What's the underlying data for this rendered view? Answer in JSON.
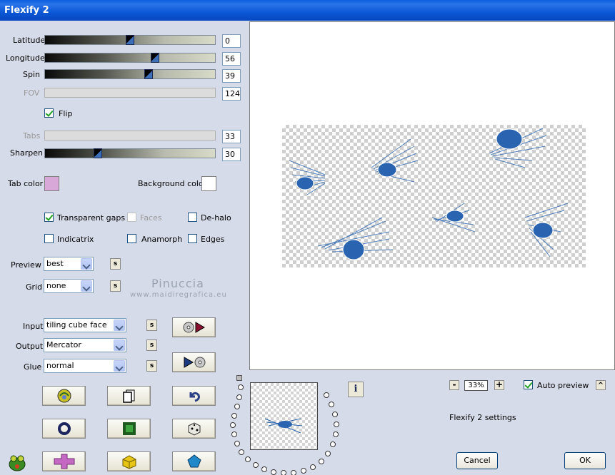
{
  "window": {
    "title": "Flexify 2"
  },
  "sliders": {
    "latitude": {
      "label": "Latitude",
      "value": "0",
      "level": 0.5
    },
    "longitude": {
      "label": "Longitude",
      "value": "56",
      "level": 0.65
    },
    "spin": {
      "label": "Spin",
      "value": "39",
      "level": 0.6
    },
    "fov": {
      "label": "FOV",
      "value": "124"
    },
    "tabs": {
      "label": "Tabs",
      "value": "33"
    },
    "sharpen": {
      "label": "Sharpen",
      "value": "30",
      "level": 0.3
    }
  },
  "flip": {
    "label": "Flip",
    "checked": true
  },
  "colors": {
    "tab_color_label": "Tab color",
    "tab_color": "#d8a8d8",
    "background_color_label": "Background color",
    "background_color": "#ffffff",
    "accent": "#2a64b0"
  },
  "options": {
    "transparent_gaps": "Transparent gaps",
    "faces": "Faces",
    "dehalo": "De-halo",
    "indicatrix": "Indicatrix",
    "anamorph": "Anamorph",
    "edges": "Edges"
  },
  "preview_select": {
    "label": "Preview",
    "value": "best"
  },
  "grid_select": {
    "label": "Grid",
    "value": "none"
  },
  "input_select": {
    "label": "Input",
    "value": "tiling cube face"
  },
  "output_select": {
    "label": "Output",
    "value": "Mercator"
  },
  "glue_select": {
    "label": "Glue",
    "value": "normal"
  },
  "s_label": "s",
  "watermark": {
    "name": "Pinuccia",
    "site": "www.maidiregrafica.eu"
  },
  "zoom": {
    "minus": "-",
    "value": "33%",
    "plus": "+"
  },
  "auto_preview": {
    "label": "Auto preview",
    "checked": true,
    "caret": "^"
  },
  "settings_label": "Flexify 2 settings",
  "info_label": "i",
  "buttons": {
    "cancel": "Cancel",
    "ok": "OK"
  }
}
